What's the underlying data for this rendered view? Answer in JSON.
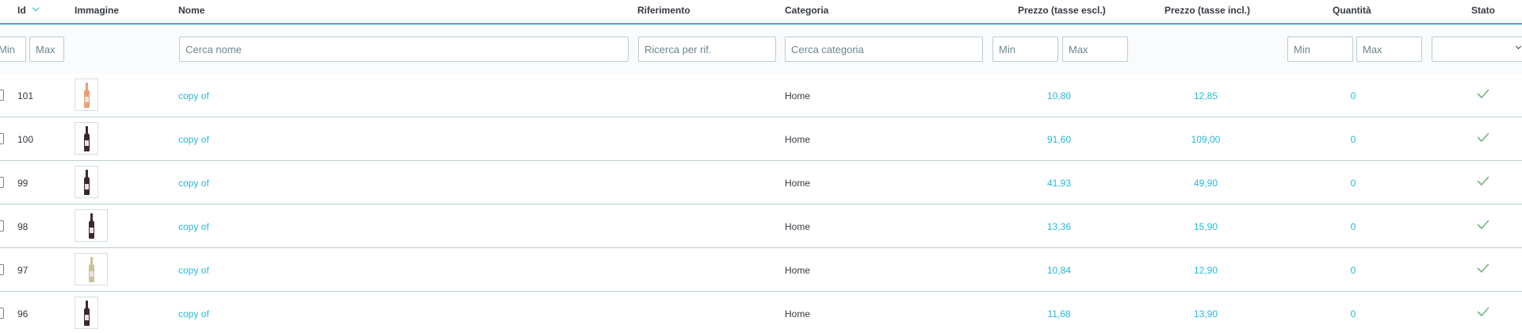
{
  "columns": {
    "id": "Id",
    "image": "Immagine",
    "name": "Nome",
    "reference": "Riferimento",
    "category": "Categoria",
    "price_excl": "Prezzo (tasse escl.)",
    "price_incl": "Prezzo (tasse incl.)",
    "quantity": "Quantità",
    "status": "Stato"
  },
  "sort_icon": "chevron-down-icon",
  "filters": {
    "id_min": "Min",
    "id_max": "Max",
    "name": "Cerca nome",
    "reference": "Ricerca per rif.",
    "category": "Cerca categoria",
    "price_min": "Min",
    "price_max": "Max",
    "qty_min": "Min",
    "qty_max": "Max"
  },
  "rows": [
    {
      "id": "101",
      "name": "copy of",
      "category": "Home",
      "price_excl": "10,80",
      "price_incl": "12,85",
      "quantity": "0",
      "status_icon": "check-icon",
      "bottle": "rose"
    },
    {
      "id": "100",
      "name": "copy of",
      "category": "Home",
      "price_excl": "91,60",
      "price_incl": "109,00",
      "quantity": "0",
      "status_icon": "check-icon",
      "bottle": "red"
    },
    {
      "id": "99",
      "name": "copy of",
      "category": "Home",
      "price_excl": "41,93",
      "price_incl": "49,90",
      "quantity": "0",
      "status_icon": "check-icon",
      "bottle": "red"
    },
    {
      "id": "98",
      "name": "copy of",
      "category": "Home",
      "price_excl": "13,36",
      "price_incl": "15,90",
      "quantity": "0",
      "status_icon": "check-icon",
      "bottle": "red"
    },
    {
      "id": "97",
      "name": "copy of",
      "category": "Home",
      "price_excl": "10,84",
      "price_incl": "12,90",
      "quantity": "0",
      "status_icon": "check-icon",
      "bottle": "white"
    },
    {
      "id": "96",
      "name": "copy of",
      "category": "Home",
      "price_excl": "11,68",
      "price_incl": "13,90",
      "quantity": "0",
      "status_icon": "check-icon",
      "bottle": "red"
    }
  ],
  "colors": {
    "accent": "#25b9d7",
    "status_ok": "#70b580",
    "text": "#363a41",
    "border": "#bbcdd2",
    "bottle_red": "#3a2a2e",
    "bottle_rose": "#e8a07a",
    "bottle_white": "#c9c29a"
  }
}
